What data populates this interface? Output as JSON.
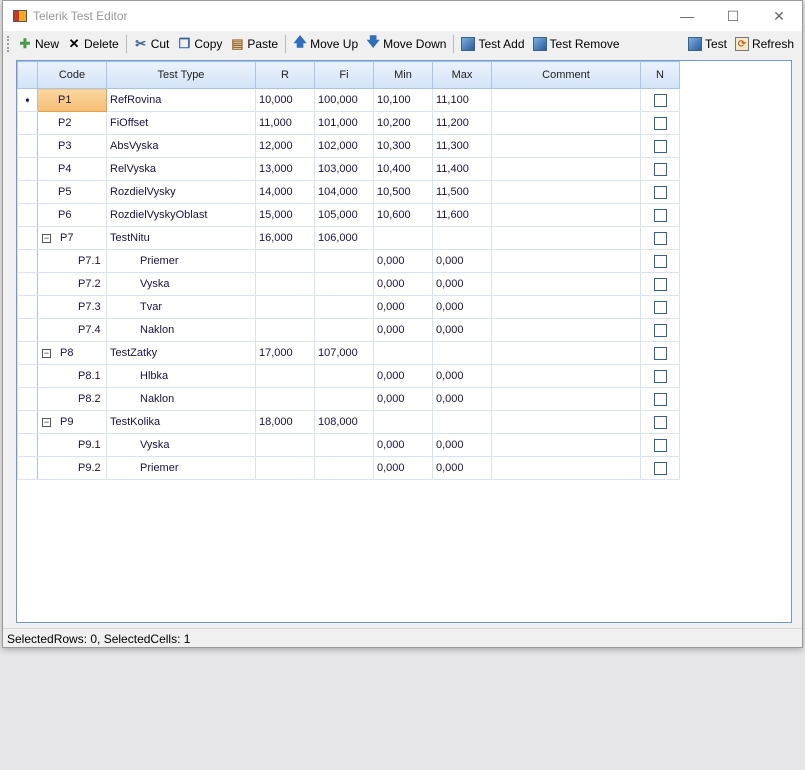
{
  "window": {
    "title": "Telerik Test Editor",
    "minimize": "—",
    "maximize": "☐",
    "close": "✕"
  },
  "toolbar": {
    "new": "New",
    "delete": "Delete",
    "cut": "Cut",
    "copy": "Copy",
    "paste": "Paste",
    "move_up": "Move Up",
    "move_down": "Move Down",
    "test_add": "Test Add",
    "test_remove": "Test Remove",
    "test": "Test",
    "refresh": "Refresh"
  },
  "grid": {
    "columns": [
      "Code",
      "Test Type",
      "R",
      "Fi",
      "Min",
      "Max",
      "Comment",
      "N"
    ],
    "rows": [
      {
        "level": 0,
        "code": "P1",
        "type": "RefRovina",
        "r": "10,000",
        "fi": "100,000",
        "min": "10,100",
        "max": "11,100",
        "comment": "",
        "n": false,
        "current": true
      },
      {
        "level": 0,
        "code": "P2",
        "type": "FiOffset",
        "r": "11,000",
        "fi": "101,000",
        "min": "10,200",
        "max": "11,200",
        "comment": "",
        "n": false
      },
      {
        "level": 0,
        "code": "P3",
        "type": "AbsVyska",
        "r": "12,000",
        "fi": "102,000",
        "min": "10,300",
        "max": "11,300",
        "comment": "",
        "n": false
      },
      {
        "level": 0,
        "code": "P4",
        "type": "RelVyska",
        "r": "13,000",
        "fi": "103,000",
        "min": "10,400",
        "max": "11,400",
        "comment": "",
        "n": false
      },
      {
        "level": 0,
        "code": "P5",
        "type": "RozdielVysky",
        "r": "14,000",
        "fi": "104,000",
        "min": "10,500",
        "max": "11,500",
        "comment": "",
        "n": false
      },
      {
        "level": 0,
        "code": "P6",
        "type": "RozdielVyskyOblast",
        "r": "15,000",
        "fi": "105,000",
        "min": "10,600",
        "max": "11,600",
        "comment": "",
        "n": false
      },
      {
        "level": "group",
        "code": "P7",
        "type": "TestNitu",
        "r": "16,000",
        "fi": "106,000",
        "min": "",
        "max": "",
        "comment": "",
        "n": false
      },
      {
        "level": 1,
        "code": "P7.1",
        "type": "Priemer",
        "r": "",
        "fi": "",
        "min": "0,000",
        "max": "0,000",
        "comment": "",
        "n": false
      },
      {
        "level": 1,
        "code": "P7.2",
        "type": "Vyska",
        "r": "",
        "fi": "",
        "min": "0,000",
        "max": "0,000",
        "comment": "",
        "n": false
      },
      {
        "level": 1,
        "code": "P7.3",
        "type": "Tvar",
        "r": "",
        "fi": "",
        "min": "0,000",
        "max": "0,000",
        "comment": "",
        "n": false
      },
      {
        "level": 1,
        "code": "P7.4",
        "type": "Naklon",
        "r": "",
        "fi": "",
        "min": "0,000",
        "max": "0,000",
        "comment": "",
        "n": false
      },
      {
        "level": "group",
        "code": "P8",
        "type": "TestZatky",
        "r": "17,000",
        "fi": "107,000",
        "min": "",
        "max": "",
        "comment": "",
        "n": false
      },
      {
        "level": 1,
        "code": "P8.1",
        "type": "Hlbka",
        "r": "",
        "fi": "",
        "min": "0,000",
        "max": "0,000",
        "comment": "",
        "n": false
      },
      {
        "level": 1,
        "code": "P8.2",
        "type": "Naklon",
        "r": "",
        "fi": "",
        "min": "0,000",
        "max": "0,000",
        "comment": "",
        "n": false
      },
      {
        "level": "group",
        "code": "P9",
        "type": "TestKolika",
        "r": "18,000",
        "fi": "108,000",
        "min": "",
        "max": "",
        "comment": "",
        "n": false
      },
      {
        "level": 1,
        "code": "P9.1",
        "type": "Vyska",
        "r": "",
        "fi": "",
        "min": "0,000",
        "max": "0,000",
        "comment": "",
        "n": false
      },
      {
        "level": 1,
        "code": "P9.2",
        "type": "Priemer",
        "r": "",
        "fi": "",
        "min": "0,000",
        "max": "0,000",
        "comment": "",
        "n": false
      }
    ]
  },
  "status": "SelectedRows: 0, SelectedCells: 1"
}
